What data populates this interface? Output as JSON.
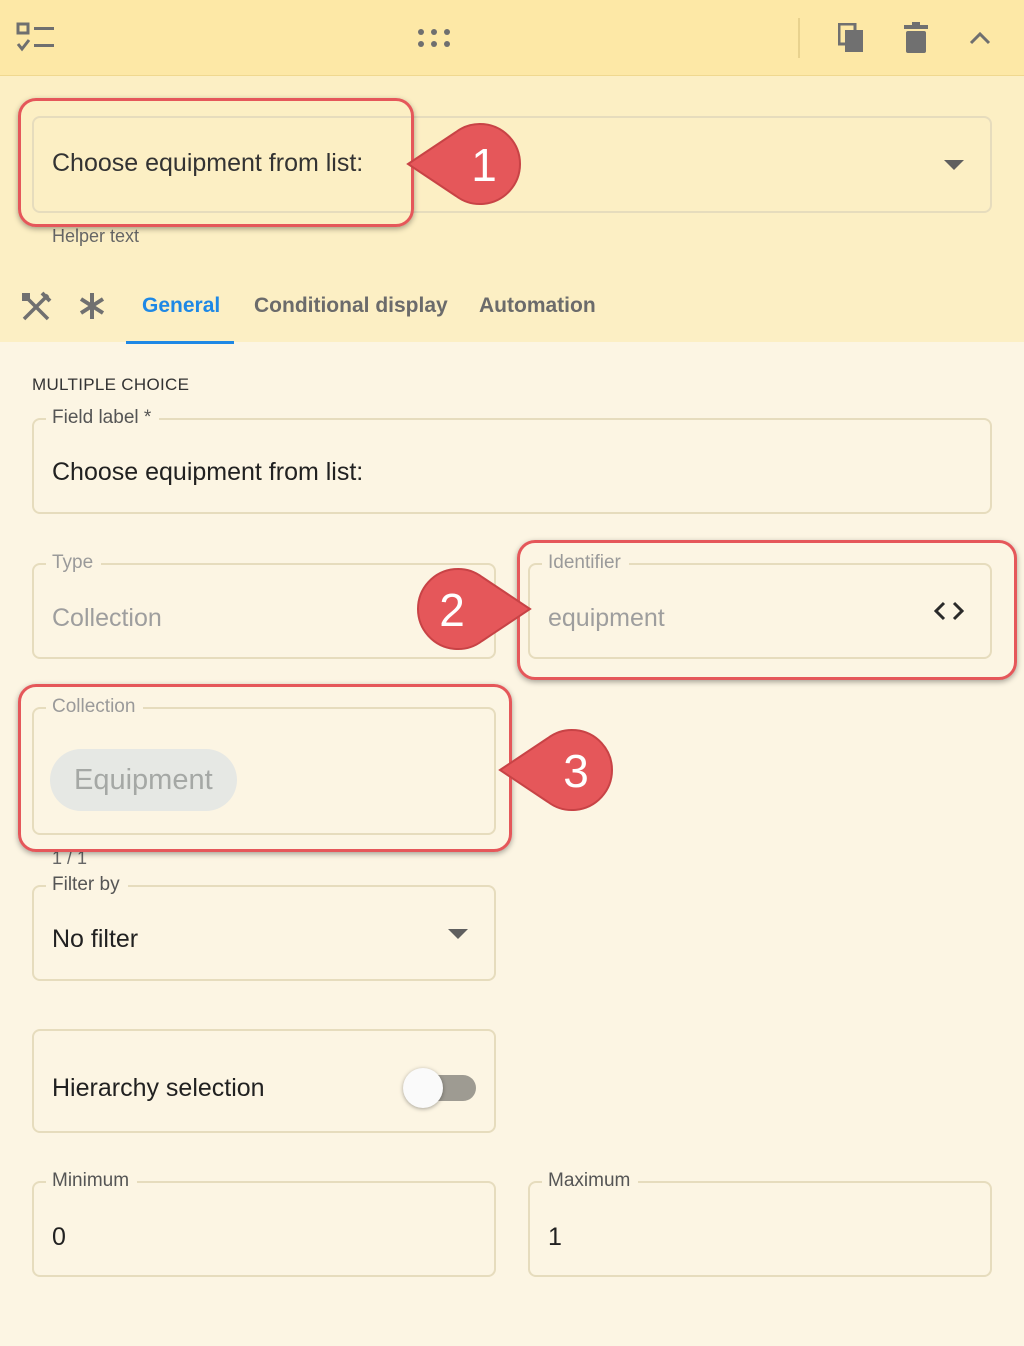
{
  "header": {
    "drag_icon": "drag-dots-icon",
    "type_icon": "checklist-icon",
    "duplicate_icon": "copy-icon",
    "delete_icon": "trash-icon",
    "collapse_icon": "chevron-up-icon"
  },
  "preview": {
    "select_label": "Choose equipment from list:",
    "helper_text": "Helper text"
  },
  "tabs": {
    "items": [
      "General",
      "Conditional display",
      "Automation"
    ],
    "active": "General"
  },
  "section": {
    "title": "MULTIPLE CHOICE"
  },
  "fields": {
    "field_label": {
      "label": "Field label *",
      "value": "Choose equipment from list:"
    },
    "type": {
      "label": "Type",
      "value": "Collection"
    },
    "identifier": {
      "label": "Identifier",
      "value": "equipment"
    },
    "collection": {
      "label": "Collection",
      "chip": "Equipment",
      "counter": "1 / 1"
    },
    "filter_by": {
      "label": "Filter by",
      "value": "No filter"
    },
    "hierarchy": {
      "label": "Hierarchy selection",
      "enabled": false
    },
    "minimum": {
      "label": "Minimum",
      "value": "0"
    },
    "maximum": {
      "label": "Maximum",
      "value": "1"
    }
  },
  "annotations": [
    "1",
    "2",
    "3"
  ],
  "colors": {
    "header_bg": "#fde8a6",
    "panel_bg": "#fcf5e3",
    "accent": "#1e88e5",
    "annotation": "#e5575a"
  }
}
